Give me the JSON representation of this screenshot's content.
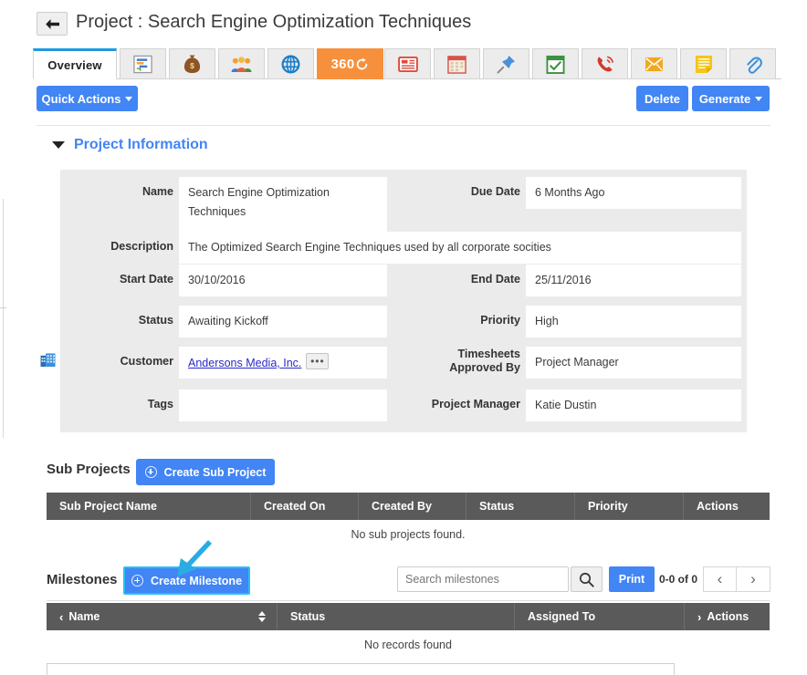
{
  "header": {
    "back_icon": "arrow-left-icon",
    "title": "Project : Search Engine Optimization Techniques"
  },
  "tabs": [
    {
      "label": "Overview",
      "icon": "overview-tab",
      "active": true
    },
    {
      "label": "",
      "icon": "gantt-chart-icon",
      "active": false
    },
    {
      "label": "",
      "icon": "money-bag-icon",
      "active": false
    },
    {
      "label": "",
      "icon": "people-group-icon",
      "active": false
    },
    {
      "label": "",
      "icon": "globe-icon",
      "active": false
    },
    {
      "label": "360",
      "icon": "360-refresh-icon",
      "active": false
    },
    {
      "label": "",
      "icon": "news-list-icon",
      "active": false
    },
    {
      "label": "",
      "icon": "calendar-icon",
      "active": false
    },
    {
      "label": "",
      "icon": "pushpin-icon",
      "active": false
    },
    {
      "label": "",
      "icon": "checked-calendar-icon",
      "active": false
    },
    {
      "label": "",
      "icon": "phone-call-icon",
      "active": false
    },
    {
      "label": "",
      "icon": "envelope-icon",
      "active": false
    },
    {
      "label": "",
      "icon": "note-icon",
      "active": false
    },
    {
      "label": "",
      "icon": "paperclip-icon",
      "active": false
    }
  ],
  "toolbar": {
    "quick_actions_label": "Quick Actions",
    "delete_label": "Delete",
    "generate_label": "Generate"
  },
  "section": {
    "title": "Project Information",
    "collapse_icon": "chevron-down-icon"
  },
  "fields": {
    "name_label": "Name",
    "name_value": "Search Engine Optimization Techniques",
    "due_date_label": "Due Date",
    "due_date_value": "6 Months Ago",
    "description_label": "Description",
    "description_value": "The Optimized Search Engine Techniques used by all corporate socities",
    "start_date_label": "Start Date",
    "start_date_value": "30/10/2016",
    "end_date_label": "End Date",
    "end_date_value": "25/11/2016",
    "status_label": "Status",
    "status_value": "Awaiting Kickoff",
    "priority_label": "Priority",
    "priority_value": "High",
    "customer_label": "Customer",
    "customer_value": "Andersons Media, Inc.",
    "customer_more": "•••",
    "timesheets_label_line1": "Timesheets",
    "timesheets_label_line2": "Approved By",
    "timesheets_value": "Project Manager",
    "tags_label": "Tags",
    "tags_value": "",
    "project_manager_label": "Project Manager",
    "project_manager_value": "Katie Dustin"
  },
  "sub_projects": {
    "title": "Sub Projects",
    "create_label": "Create Sub Project",
    "columns": [
      "Sub Project Name",
      "Created On",
      "Created By",
      "Status",
      "Priority",
      "Actions"
    ],
    "empty_text": "No sub projects found."
  },
  "milestones": {
    "title": "Milestones",
    "create_label": "Create Milestone",
    "search_placeholder": "Search milestones",
    "search_value": "",
    "search_icon": "magnifier-icon",
    "print_label": "Print",
    "count_text": "0-0 of 0",
    "prev_label": "‹",
    "next_label": "›",
    "columns": [
      "Name",
      "Status",
      "Assigned To",
      "Actions"
    ],
    "empty_text": "No records found"
  },
  "colors": {
    "primary_blue": "#4285f4",
    "tab_active_underline": "#1e9ae0",
    "orange_tab": "#f7903d",
    "header_gray": "#5a5a5a",
    "panel_gray": "#ebebeb",
    "annotation_cyan": "#29c0f0",
    "link_blue": "#2a2aca"
  }
}
